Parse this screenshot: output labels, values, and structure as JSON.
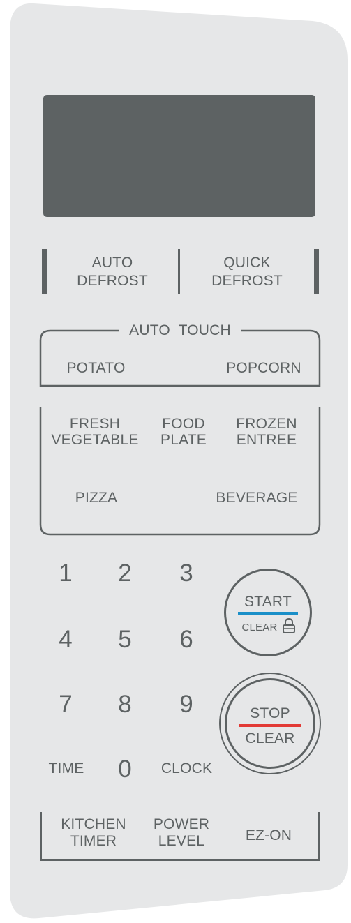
{
  "display": {
    "color": "#5d6263"
  },
  "defrost": {
    "auto": [
      "AUTO",
      "DEFROST"
    ],
    "quick": [
      "QUICK",
      "DEFROST"
    ]
  },
  "auto_touch": {
    "title": "AUTO  TOUCH",
    "potato": "POTATO",
    "popcorn": "POPCORN"
  },
  "menu": {
    "fresh_vegetable": [
      "FRESH",
      "VEGETABLE"
    ],
    "food_plate": [
      "FOOD",
      "PLATE"
    ],
    "frozen_entree": [
      "FROZEN",
      "ENTREE"
    ],
    "pizza": "PIZZA",
    "beverage": "BEVERAGE"
  },
  "keypad": {
    "digits": [
      "1",
      "2",
      "3",
      "4",
      "5",
      "6",
      "7",
      "8",
      "9",
      "0"
    ],
    "time": "TIME",
    "clock": "CLOCK"
  },
  "start": {
    "label": "START",
    "sub": "CLEAR",
    "accent": "#1a8fc8",
    "icon": "lock-icon"
  },
  "stop": {
    "label": "STOP",
    "sub": "CLEAR",
    "accent": "#e23a35"
  },
  "bottom": {
    "kitchen_timer": [
      "KITCHEN",
      "TIMER"
    ],
    "power_level": [
      "POWER",
      "LEVEL"
    ],
    "ez_on": "EZ-ON"
  },
  "colors": {
    "panel": "#e6e7e8",
    "text": "#5d6263",
    "display": "#5d6263"
  }
}
